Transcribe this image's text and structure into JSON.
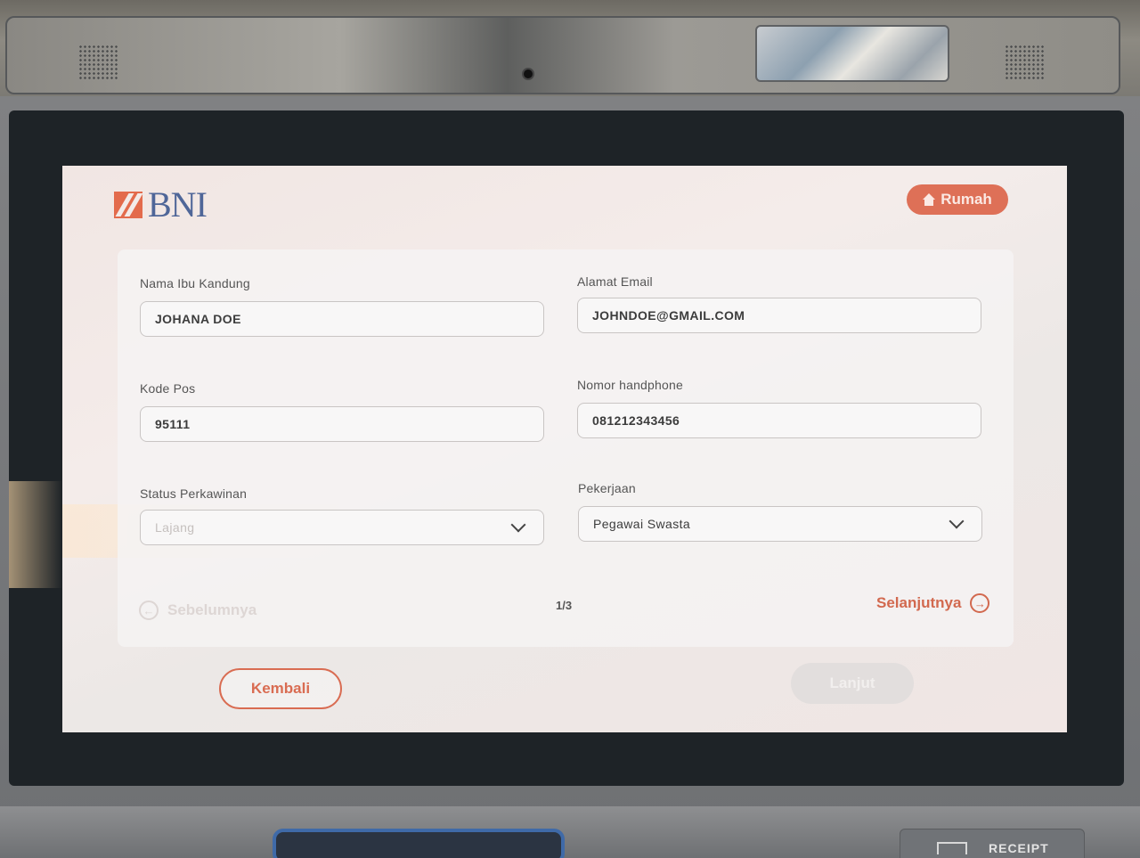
{
  "brand": {
    "name": "BNI",
    "color": "#4f6698",
    "accent": "#e36b4c"
  },
  "header": {
    "home_label": "Rumah"
  },
  "form": {
    "mother_name": {
      "label": "Nama Ibu Kandung",
      "value": "JOHANA DOE"
    },
    "email": {
      "label": "Alamat Email",
      "value": "JOHNDOE@GMAIL.COM"
    },
    "postal_code": {
      "label": "Kode Pos",
      "value": "95111"
    },
    "phone": {
      "label": "Nomor handphone",
      "value": "081212343456"
    },
    "marital_status": {
      "label": "Status Perkawinan",
      "value": "Lajang"
    },
    "occupation": {
      "label": "Pekerjaan",
      "value": "Pegawai Swasta"
    }
  },
  "pager": {
    "prev_label": "Sebelumnya",
    "page": "1/3",
    "next_label": "Selanjutnya"
  },
  "footer": {
    "back_label": "Kembali",
    "continue_label": "Lanjut"
  },
  "hardware": {
    "receipt_label": "RECEIPT"
  },
  "icons": [
    "home-icon",
    "chevron-down-icon",
    "arrow-left-circle-icon",
    "arrow-right-circle-icon",
    "receipt-icon"
  ]
}
